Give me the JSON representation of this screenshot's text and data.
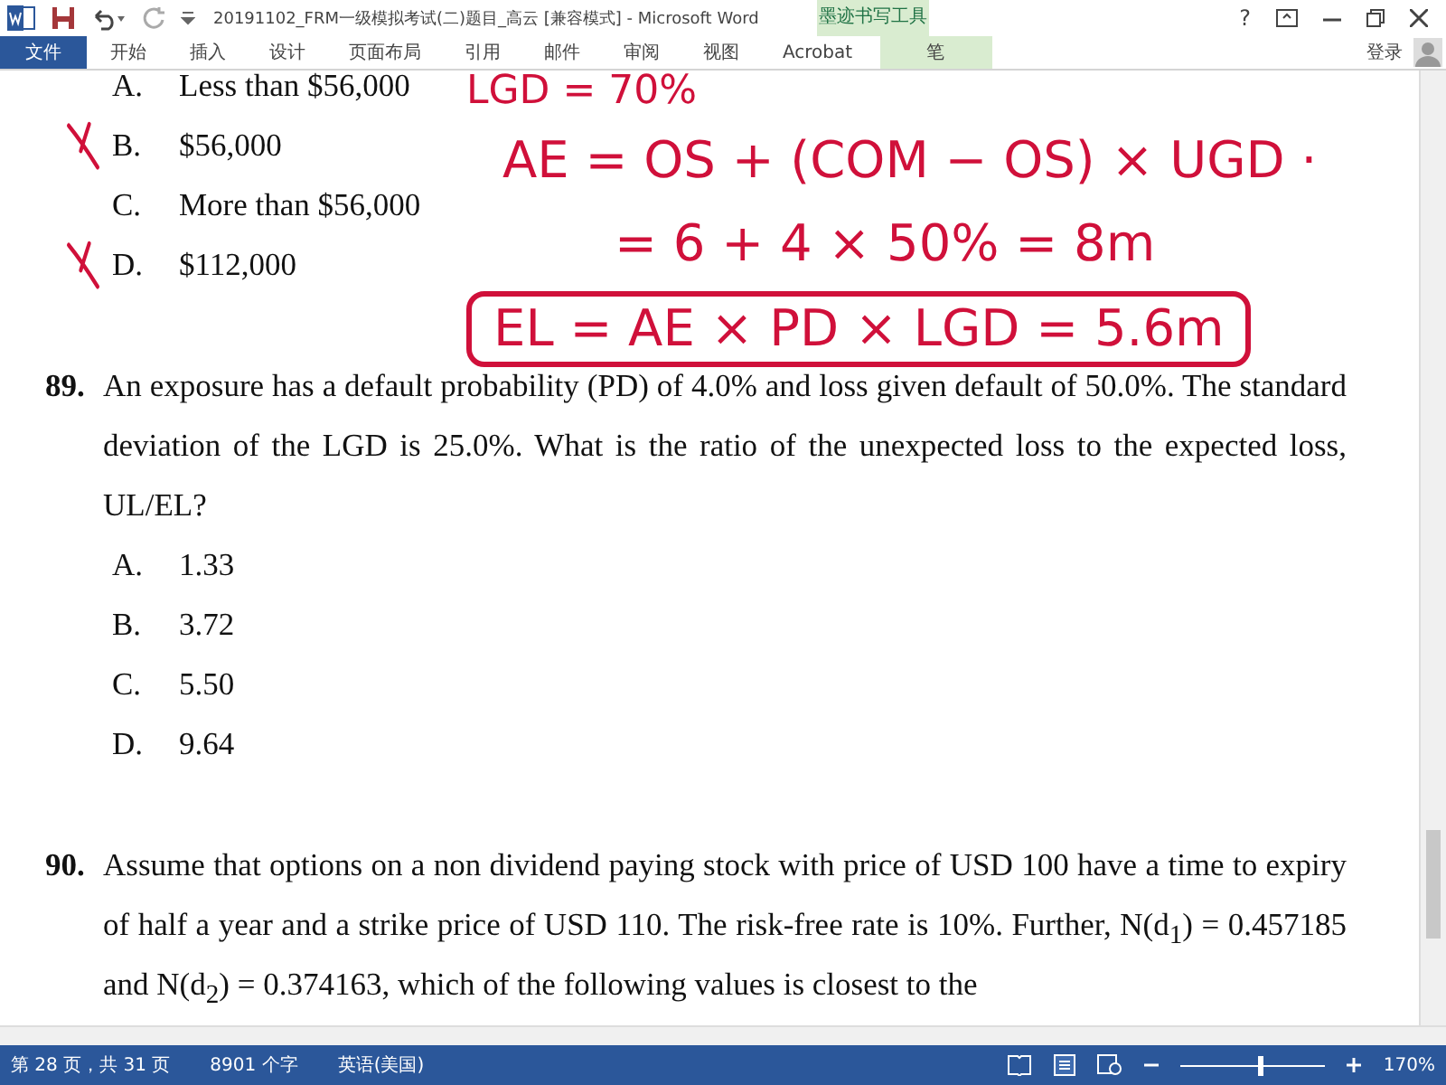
{
  "window": {
    "title": "20191102_FRM一级模拟考试(二)题目_高云 [兼容模式] - Microsoft Word",
    "controls": [
      "?"
    ]
  },
  "ribbon": {
    "tabs": [
      {
        "label": "文件",
        "kind": "file",
        "selected": false
      },
      {
        "label": "开始",
        "kind": "tab",
        "selected": false
      },
      {
        "label": "插入",
        "kind": "tab",
        "selected": false
      },
      {
        "label": "设计",
        "kind": "tab",
        "selected": false
      },
      {
        "label": "页面布局",
        "kind": "tab",
        "selected": false
      },
      {
        "label": "引用",
        "kind": "tab",
        "selected": false
      },
      {
        "label": "邮件",
        "kind": "tab",
        "selected": false
      },
      {
        "label": "审阅",
        "kind": "tab",
        "selected": false
      },
      {
        "label": "视图",
        "kind": "tab",
        "selected": false
      },
      {
        "label": "Acrobat",
        "kind": "tab",
        "selected": false
      },
      {
        "label": "笔",
        "kind": "contextual",
        "group": "墨迹书写工具",
        "selected": false
      }
    ],
    "account": "登录"
  },
  "document": {
    "previous_options": [
      {
        "letter": "A.",
        "text": "Less than $56,000",
        "marked": false
      },
      {
        "letter": "B.",
        "text": "$56,000",
        "marked": true
      },
      {
        "letter": "C.",
        "text": "More than $56,000",
        "marked": false
      },
      {
        "letter": "D.",
        "text": "$112,000",
        "marked": true
      }
    ],
    "questions": [
      {
        "number": "89.",
        "text": "An exposure has a default probability (PD) of 4.0% and loss given default of 50.0%. The standard deviation of the LGD is 25.0%. What is the ratio of the unexpected loss to the expected loss, UL/EL?",
        "options": [
          {
            "letter": "A.",
            "text": "1.33"
          },
          {
            "letter": "B.",
            "text": "3.72"
          },
          {
            "letter": "C.",
            "text": "5.50"
          },
          {
            "letter": "D.",
            "text": "9.64"
          }
        ]
      },
      {
        "number": "90.",
        "text": "Assume that options on a non dividend paying stock with price of USD 100 have a time to expiry of half a year and a strike price of USD 110. The risk-free rate is 10%. Further, N(d$_{1}$) = 0.457185 and N(d$_{2}$) = 0.374163, which of the following values is closest to the"
      }
    ],
    "ink": [
      {
        "text": "LGD = 70%",
        "boxed": false
      },
      {
        "text": "AE = OS + (COM − OS) × UGD ·",
        "boxed": false
      },
      {
        "text": "= 6 + 4 × 50% = 8m",
        "boxed": false
      },
      {
        "text": "EL = AE × PD × LGD = 5.6m",
        "boxed": true
      }
    ]
  },
  "status_bar": {
    "page": "第 28 页，共 31 页",
    "words": "8901 个字",
    "language": "英语(美国)",
    "zoom": "170%",
    "zoom_slider": {
      "level": 0.55
    }
  }
}
